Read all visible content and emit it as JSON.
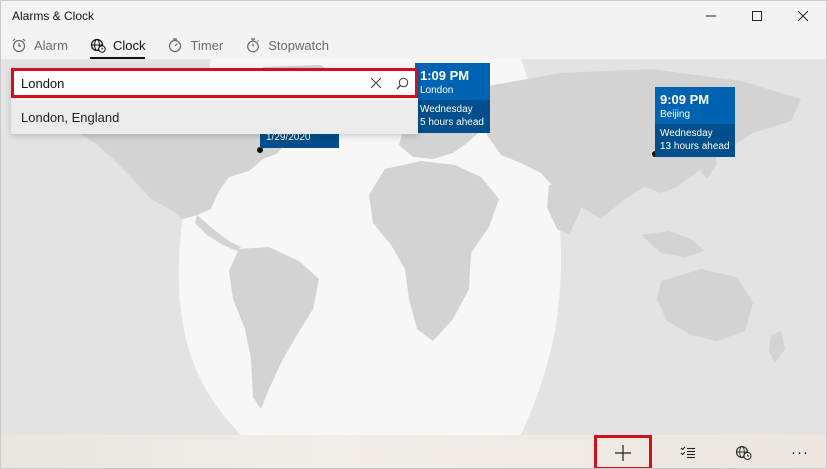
{
  "app": {
    "title": "Alarms & Clock"
  },
  "window_controls": [
    "minimize",
    "maximize",
    "close"
  ],
  "tabs": [
    {
      "label": "Alarm",
      "icon": "alarm-icon",
      "active": false
    },
    {
      "label": "Clock",
      "icon": "globe-clock-icon",
      "active": true
    },
    {
      "label": "Timer",
      "icon": "timer-icon",
      "active": false
    },
    {
      "label": "Stopwatch",
      "icon": "stopwatch-icon",
      "active": false
    }
  ],
  "search": {
    "value": "London",
    "placeholder": "",
    "clear_icon": "close-icon",
    "search_icon": "search-icon",
    "suggestions": [
      "London, England"
    ]
  },
  "cities": [
    {
      "id": "local",
      "date": "1/29/2020"
    },
    {
      "id": "london",
      "time": "1:09 PM",
      "name": "London",
      "day": "Wednesday",
      "offset": "5 hours ahead"
    },
    {
      "id": "beijing",
      "time": "9:09 PM",
      "name": "Beijing",
      "day": "Wednesday",
      "offset": "13 hours ahead"
    }
  ],
  "bottom_bar": {
    "buttons": [
      {
        "name": "add-button",
        "icon": "plus-icon",
        "label": "+"
      },
      {
        "name": "select-button",
        "icon": "checklist-icon"
      },
      {
        "name": "compare-button",
        "icon": "compare-clock-icon"
      },
      {
        "name": "more-button",
        "icon": "more-icon",
        "label": "···"
      }
    ]
  },
  "colors": {
    "accent": "#0063b1",
    "accent_dark": "#004e8c",
    "highlight": "#d0111b"
  }
}
